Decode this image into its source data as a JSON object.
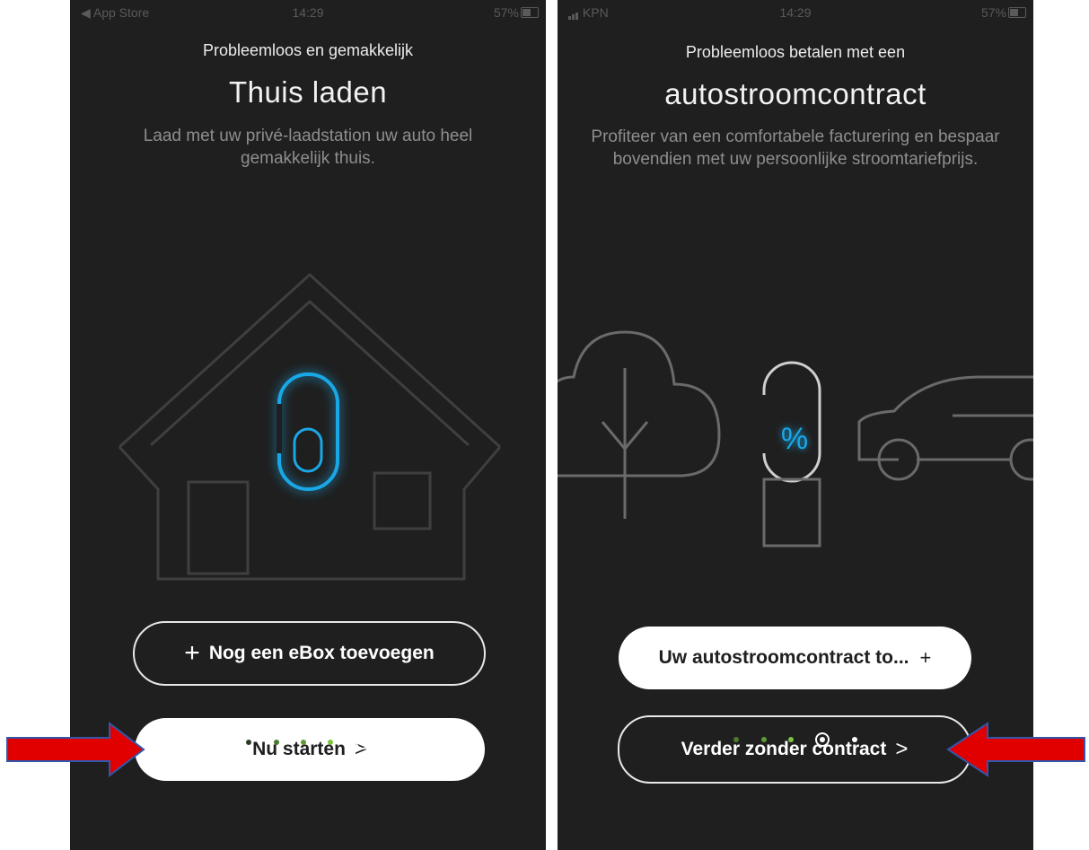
{
  "left_screen": {
    "status": {
      "back_label": "◀ App Store",
      "time": "14:29",
      "battery": "57%"
    },
    "subtitle": "Probleemloos en gemakkelijk",
    "title": "Thuis laden",
    "description": "Laad met uw privé-laadstation uw auto heel gemakkelijk thuis.",
    "add_button_label": "Nog een eBox toevoegen",
    "start_button_label": "Nu starten",
    "page_indicator": {
      "total": 5,
      "current": 5
    }
  },
  "right_screen": {
    "status": {
      "carrier": "KPN",
      "time": "14:29",
      "battery": "57%"
    },
    "subtitle": "Probleemloos betalen met een",
    "title": "autostroomcontract",
    "description": "Profiteer van een comfortabele facturering en bespaar bovendien met uw persoonlijke stroomtariefprijs.",
    "contract_button_label": "Uw autostroomcontract to...",
    "continue_button_label": "Verder zonder contract",
    "percent_symbol": "%",
    "page_indicator": {
      "total": 5,
      "current": 4
    }
  },
  "colors": {
    "background": "#1f1f1f",
    "accent_blue": "#1aa7e6",
    "dot_green": "#7cc43f",
    "annotation_arrow": "#e00000"
  }
}
